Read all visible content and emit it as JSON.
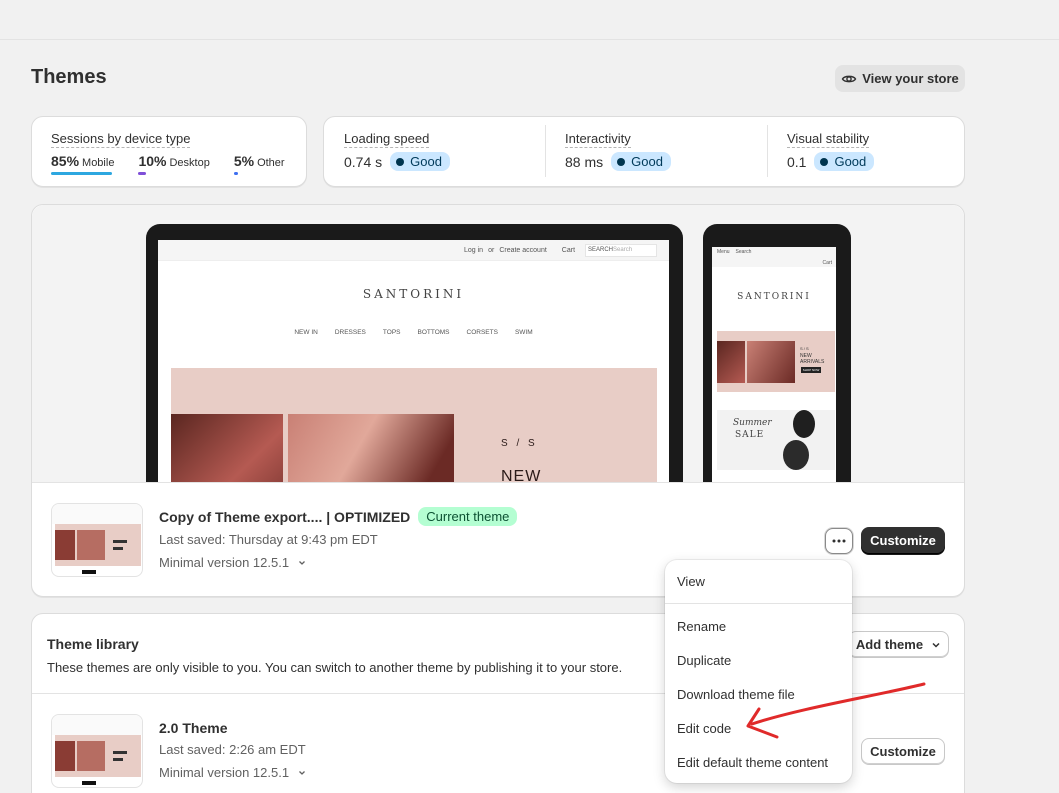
{
  "page": {
    "title": "Themes"
  },
  "header": {
    "view_store_label": "View your store",
    "view_store_icon": "eye-icon"
  },
  "sessions": {
    "label": "Sessions by device type",
    "items": [
      {
        "pct": "85%",
        "label": "Mobile",
        "color": "#2da7e0",
        "share": 0.85
      },
      {
        "pct": "10%",
        "label": "Desktop",
        "color": "#7f4fd8",
        "share": 0.1
      },
      {
        "pct": "5%",
        "label": "Other",
        "color": "#3e6ff0",
        "share": 0.05
      }
    ]
  },
  "web_vitals": [
    {
      "label": "Loading speed",
      "value": "0.74 s",
      "status": "Good"
    },
    {
      "label": "Interactivity",
      "value": "88 ms",
      "status": "Good"
    },
    {
      "label": "Visual stability",
      "value": "0.1",
      "status": "Good"
    }
  ],
  "preview": {
    "brand": "SANTORINI",
    "desktop_top_links": [
      "Log in",
      "or",
      "Create account",
      "Cart"
    ],
    "desktop_search": "SEARCH",
    "desktop_search_placeholder": "Search",
    "desktop_nav": [
      "NEW IN",
      "DRESSES",
      "TOPS",
      "BOTTOMS",
      "CORSETS",
      "SWIM"
    ],
    "hero_text_1": "S / S",
    "hero_text_2": "NEW",
    "mobile_nav": [
      "Menu",
      "Search"
    ],
    "mobile_cart": "Cart",
    "mobile_banner_1_small": "S / S",
    "mobile_banner_1_title": "NEW\nARRIVALS",
    "mobile_banner_1_button": "SHOP NOW",
    "mobile_banner_2_title": "Summer",
    "mobile_banner_2_subtitle": "SALE"
  },
  "current_theme": {
    "name": "Copy of Theme export.... | OPTIMIZED",
    "badge": "Current theme",
    "last_saved": "Last saved: Thursday at 9:43 pm EDT",
    "version": "Minimal version 12.5.1",
    "more_icon": "ellipsis-icon",
    "customize_label": "Customize"
  },
  "library": {
    "title": "Theme library",
    "description": "These themes are only visible to you. You can switch to another theme by publishing it to your store.",
    "add_theme_label": "Add theme",
    "themes": [
      {
        "name": "2.0 Theme",
        "last_saved": "Last saved: 2:26 am EDT",
        "version": "Minimal version 12.5.1",
        "customize_label": "Customize"
      }
    ]
  },
  "menu": {
    "items": [
      "View",
      "Rename",
      "Duplicate",
      "Download theme file",
      "Edit code",
      "Edit default theme content"
    ]
  },
  "colors": {
    "annotation_arrow": "#e02a2a",
    "good_badge_bg": "#cbe7ff",
    "current_badge_bg": "#b4fed2"
  }
}
